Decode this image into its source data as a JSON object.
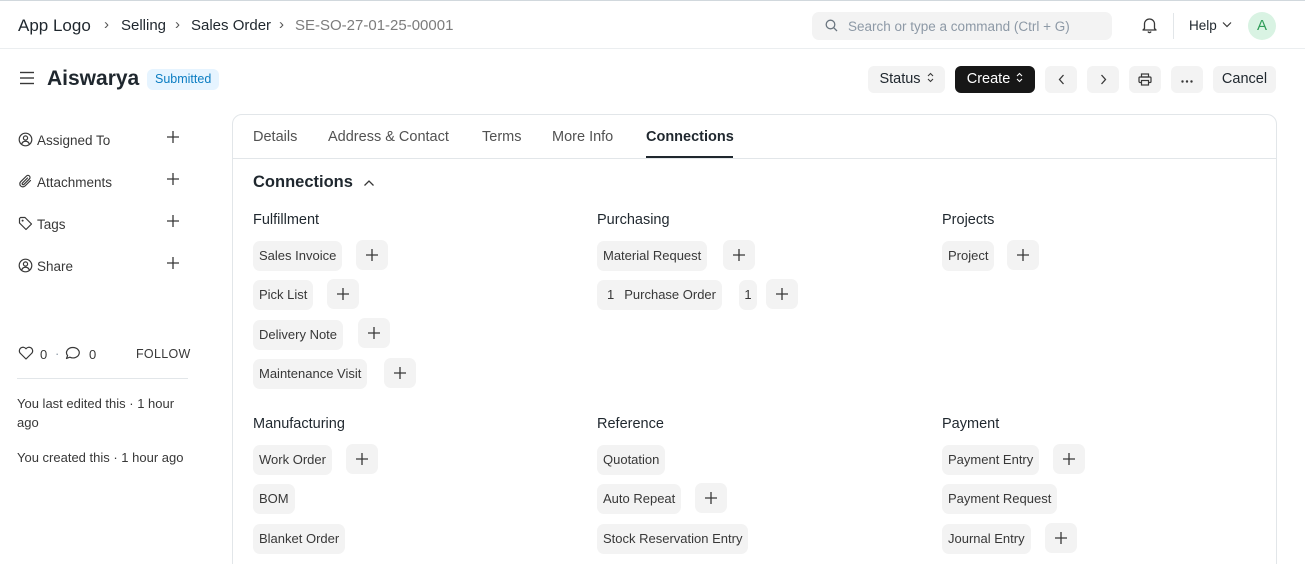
{
  "navbar": {
    "logo": "App Logo",
    "breadcrumbs": [
      "Selling",
      "Sales Order",
      "SE-SO-27-01-25-00001"
    ],
    "search_placeholder": "Search or type a command (Ctrl + G)",
    "help_label": "Help",
    "avatar_initial": "A"
  },
  "page": {
    "title": "Aiswarya",
    "status_badge": "Submitted",
    "buttons": {
      "status": "Status",
      "create": "Create",
      "cancel": "Cancel"
    }
  },
  "sidebar": {
    "items": [
      {
        "label": "Assigned To",
        "icon": "assign-icon"
      },
      {
        "label": "Attachments",
        "icon": "paperclip-icon"
      },
      {
        "label": "Tags",
        "icon": "tag-icon"
      },
      {
        "label": "Share",
        "icon": "share-icon"
      }
    ],
    "likes_count": "0",
    "comments_count": "0",
    "separator": "·",
    "follow_label": "FOLLOW",
    "activity": [
      "You last edited this · 1 hour ago",
      "You created this · 1 hour ago"
    ]
  },
  "tabs": [
    "Details",
    "Address & Contact",
    "Terms",
    "More Info",
    "Connections"
  ],
  "active_tab": "Connections",
  "connections": {
    "title": "Connections",
    "groups": [
      {
        "title": "Fulfillment",
        "items": [
          {
            "label": "Sales Invoice",
            "addable": true
          },
          {
            "label": "Pick List",
            "addable": true
          },
          {
            "label": "Delivery Note",
            "addable": true
          },
          {
            "label": "Maintenance Visit",
            "addable": true
          }
        ]
      },
      {
        "title": "Purchasing",
        "items": [
          {
            "label": "Material Request",
            "addable": true
          },
          {
            "label": "Purchase Order",
            "addable": true,
            "count_before": "1",
            "count_after": "1"
          }
        ]
      },
      {
        "title": "Projects",
        "items": [
          {
            "label": "Project",
            "addable": true
          }
        ]
      },
      {
        "title": "Manufacturing",
        "items": [
          {
            "label": "Work Order",
            "addable": true
          },
          {
            "label": "BOM",
            "addable": false
          },
          {
            "label": "Blanket Order",
            "addable": false
          }
        ]
      },
      {
        "title": "Reference",
        "items": [
          {
            "label": "Quotation",
            "addable": false
          },
          {
            "label": "Auto Repeat",
            "addable": true
          },
          {
            "label": "Stock Reservation Entry",
            "addable": false
          }
        ]
      },
      {
        "title": "Payment",
        "items": [
          {
            "label": "Payment Entry",
            "addable": true
          },
          {
            "label": "Payment Request",
            "addable": false
          },
          {
            "label": "Journal Entry",
            "addable": true
          }
        ]
      }
    ]
  }
}
